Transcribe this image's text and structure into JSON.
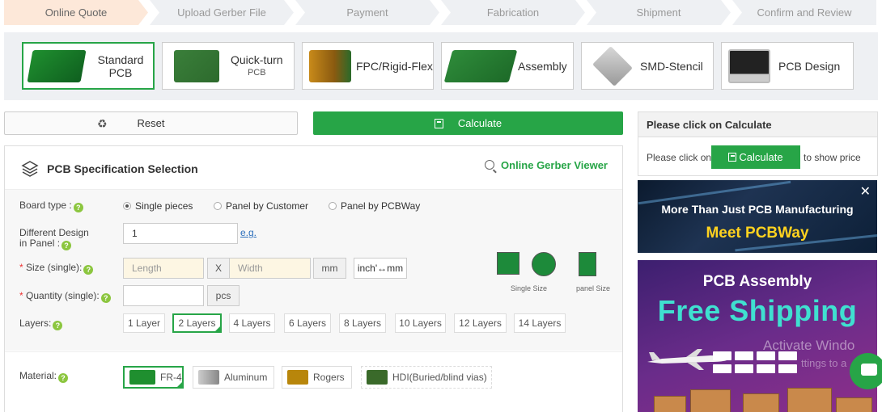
{
  "steps": [
    "Online Quote",
    "Upload Gerber File",
    "Payment",
    "Fabrication",
    "Shipment",
    "Confirm and Review"
  ],
  "products": [
    {
      "label": "Standard PCB",
      "sub": ""
    },
    {
      "label": "Quick-turn",
      "sub": "PCB"
    },
    {
      "label": "FPC/Rigid-Flex",
      "sub": ""
    },
    {
      "label": "Assembly",
      "sub": ""
    },
    {
      "label": "SMD-Stencil",
      "sub": ""
    },
    {
      "label": "PCB Design",
      "sub": ""
    }
  ],
  "actions": {
    "reset": "Reset",
    "calculate": "Calculate"
  },
  "spec": {
    "title": "PCB Specification Selection",
    "gerber_viewer": "Online Gerber Viewer",
    "board_type_label": "Board type :",
    "board_types": [
      "Single pieces",
      "Panel by Customer",
      "Panel by PCBWay"
    ],
    "different_design_label_1": "Different Design",
    "different_design_label_2": "in Panel :",
    "different_design_value": "1",
    "eg": "e.g.",
    "size_label": "Size (single):",
    "length_placeholder": "Length",
    "x": "X",
    "width_placeholder": "Width",
    "unit": "mm",
    "unit_toggle": "inch'↔mm",
    "quantity_label": "Quantity (single):",
    "quantity_unit": "pcs",
    "layers_label": "Layers:",
    "layers": [
      "1 Layer",
      "2 Layers",
      "4 Layers",
      "6 Layers",
      "8 Layers",
      "10 Layers",
      "12 Layers",
      "14 Layers"
    ],
    "single_size": "Single Size",
    "panel_size": "panel Size",
    "material_label": "Material:",
    "materials": [
      "FR-4",
      "Aluminum",
      "Rogers",
      "HDI(Buried/blind vias)"
    ]
  },
  "right_panel": {
    "head": "Please click on Calculate",
    "text_before": "Please click on",
    "button": "Calculate",
    "text_after": "to show price"
  },
  "ads": {
    "ad1_line1": "More Than Just PCB Manufacturing",
    "ad1_line2": "Meet PCBWay",
    "ad2_line1": "PCB Assembly",
    "ad2_line2": "Free Shipping"
  },
  "watermark": {
    "line1": "Activate Windo",
    "line2": "ttings to a"
  },
  "colors": {
    "green": "#27a547",
    "yellow": "#ffd21f",
    "teal": "#3fe0d0"
  }
}
